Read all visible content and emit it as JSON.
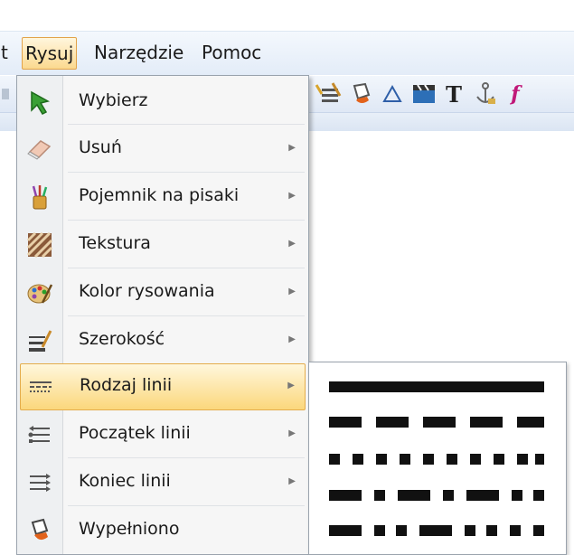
{
  "menubar": {
    "items": [
      {
        "label": "t"
      },
      {
        "label": "Rysuj",
        "active": true
      },
      {
        "label": "Narzędzie"
      },
      {
        "label": "Pomoc"
      }
    ]
  },
  "toolbar": {
    "text_tool_label": "T",
    "function_tool_label": "f"
  },
  "dropdown": {
    "items": [
      {
        "label": "Wybierz",
        "icon": "select-arrow-icon",
        "submenu": false
      },
      {
        "label": "Usuń",
        "icon": "eraser-icon",
        "submenu": true
      },
      {
        "label": "Pojemnik na pisaki",
        "icon": "pen-holder-icon",
        "submenu": true
      },
      {
        "label": "Tekstura",
        "icon": "texture-icon",
        "submenu": true
      },
      {
        "label": "Kolor rysowania",
        "icon": "palette-icon",
        "submenu": true
      },
      {
        "label": "Szerokość",
        "icon": "line-width-icon",
        "submenu": true
      },
      {
        "label": "Rodzaj linii",
        "icon": "line-type-icon",
        "submenu": true,
        "highlighted": true
      },
      {
        "label": "Początek linii",
        "icon": "line-start-icon",
        "submenu": true
      },
      {
        "label": "Koniec linii",
        "icon": "line-end-icon",
        "submenu": true
      },
      {
        "label": "Wypełniono",
        "icon": "fill-icon",
        "submenu": false
      }
    ]
  },
  "submenu": {
    "options": [
      "solid",
      "dash",
      "dot",
      "dash-dot",
      "dash-dot-dot"
    ]
  },
  "colors": {
    "highlight_top": "#fff7dc",
    "highlight_bottom": "#fbd77c",
    "highlight_border": "#e4ac4b",
    "menubar_bg": "#e3ecf8"
  }
}
